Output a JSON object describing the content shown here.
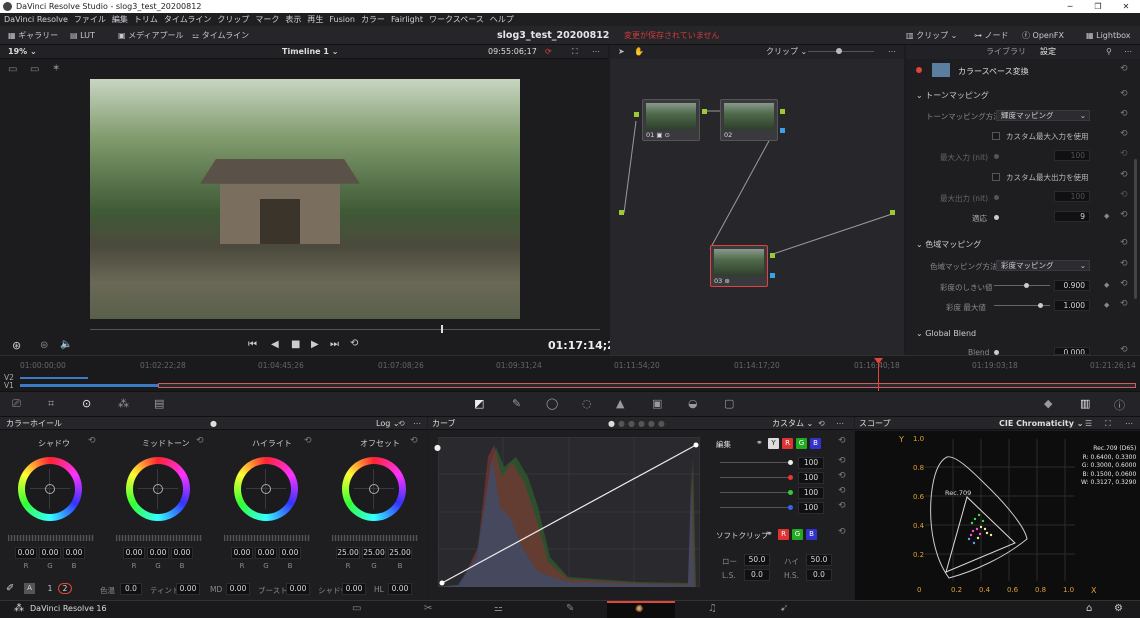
{
  "window": {
    "title": "DaVinci Resolve Studio - slog3_test_20200812",
    "controls": [
      "─",
      "❐",
      "✕"
    ]
  },
  "menu": [
    "DaVinci Resolve",
    "ファイル",
    "編集",
    "トリム",
    "タイムライン",
    "クリップ",
    "マーク",
    "表示",
    "再生",
    "Fusion",
    "カラー",
    "Fairlight",
    "ワークスペース",
    "ヘルプ"
  ],
  "toolbar": {
    "gallery": "ギャラリー",
    "lut": "LUT",
    "media_pool": "メディアプール",
    "timeline": "タイムライン",
    "project": "slog3_test_20200812",
    "unsaved": "変更が保存されていません",
    "clips": "クリップ",
    "nodes": "ノード",
    "openfx": "OpenFX",
    "lightbox": "Lightbox"
  },
  "viewer": {
    "zoom": "19%",
    "timeline_name": "Timeline 1",
    "timecode_top": "09:55:06;17",
    "timecode": "01:17:14;22"
  },
  "nodes_panel": {
    "mode": "クリップ",
    "nodes": [
      "01",
      "02",
      "03"
    ]
  },
  "inspector": {
    "tab_library": "ライブラリ",
    "tab_settings": "設定",
    "effect": "カラースペース変換",
    "tone_section": "トーンマッピング",
    "tone_method_label": "トーンマッピング方法",
    "tone_method": "輝度マッピング",
    "custom_max_in": "カスタム最大入力を使用",
    "max_in_label": "最大入力 (nit)",
    "max_in": "100",
    "custom_max_out": "カスタム最大出力を使用",
    "max_out_label": "最大出力 (nit)",
    "max_out": "100",
    "adapt_label": "適応",
    "adapt": "9",
    "gamut_section": "色域マッピング",
    "gamut_method_label": "色域マッピング方法",
    "gamut_method": "彩度マッピング",
    "sat_knee_label": "彩度のしきい値",
    "sat_knee": "0.900",
    "sat_max_label": "彩度 最大値",
    "sat_max": "1.000",
    "global_blend": "Global Blend",
    "blend_label": "Blend",
    "blend": "0.000"
  },
  "timeline": {
    "ticks": [
      "01:00:00;00",
      "01:02:22;28",
      "01:04:45;26",
      "01:07:08;26",
      "01:09:31;24",
      "01:11:54;20",
      "01:14:17;20",
      "01:16:40;18",
      "01:19:03;18",
      "01:21:26;14"
    ],
    "tracks": [
      "V2",
      "V1"
    ]
  },
  "wheels": {
    "title": "カラーホイール",
    "mode": "Log",
    "items": [
      {
        "name": "シャドウ",
        "r": "0.00",
        "g": "0.00",
        "b": "0.00"
      },
      {
        "name": "ミッドトーン",
        "r": "0.00",
        "g": "0.00",
        "b": "0.00"
      },
      {
        "name": "ハイライト",
        "r": "0.00",
        "g": "0.00",
        "b": "0.00"
      },
      {
        "name": "オフセット",
        "r": "25.00",
        "g": "25.00",
        "b": "25.00"
      }
    ],
    "rgb_labels": [
      "R",
      "G",
      "B"
    ],
    "footer": {
      "page1": "1",
      "page2": "2",
      "temp_label": "色温",
      "temp": "0.0",
      "tint_label": "ティント",
      "tint": "0.00",
      "md_label": "MD",
      "md": "0.00",
      "boost_label": "ブースト",
      "boost": "0.00",
      "shadow_label": "シャドウ",
      "shadow": "0.00",
      "hl_label": "HL",
      "hl": "0.00"
    }
  },
  "curves": {
    "title": "カーブ",
    "mode": "カスタム",
    "edit_label": "編集",
    "y_chip": "Y",
    "r_chip": "R",
    "g_chip": "G",
    "b_chip": "B",
    "intensities": [
      "100",
      "100",
      "100",
      "100"
    ],
    "soft_clip": "ソフトクリップ",
    "low_label": "ロー",
    "low": "50.0",
    "high_label": "ハイ",
    "high": "50.0",
    "ls_label": "L.S.",
    "ls": "0.0",
    "hs_label": "H.S.",
    "hs": "0.0"
  },
  "scope": {
    "title": "スコープ",
    "type": "CIE Chromaticity",
    "legend": [
      "Rec.709 (D65)",
      "R: 0.6400, 0.3300",
      "G: 0.3000, 0.6000",
      "B: 0.1500, 0.0600",
      "W: 0.3127, 0.3290"
    ],
    "gamut_label": "Rec.709",
    "y_axis": "Y",
    "x_axis": "X",
    "y_ticks": [
      "1.0",
      "0.8",
      "0.6",
      "0.4",
      "0.2",
      "0"
    ],
    "x_ticks": [
      "0.2",
      "0.4",
      "0.6",
      "0.8",
      "1.0"
    ]
  },
  "status": {
    "app": "DaVinci Resolve 16"
  },
  "colors": {
    "accent": "#e0443a",
    "bg": "#1c1c1f"
  }
}
